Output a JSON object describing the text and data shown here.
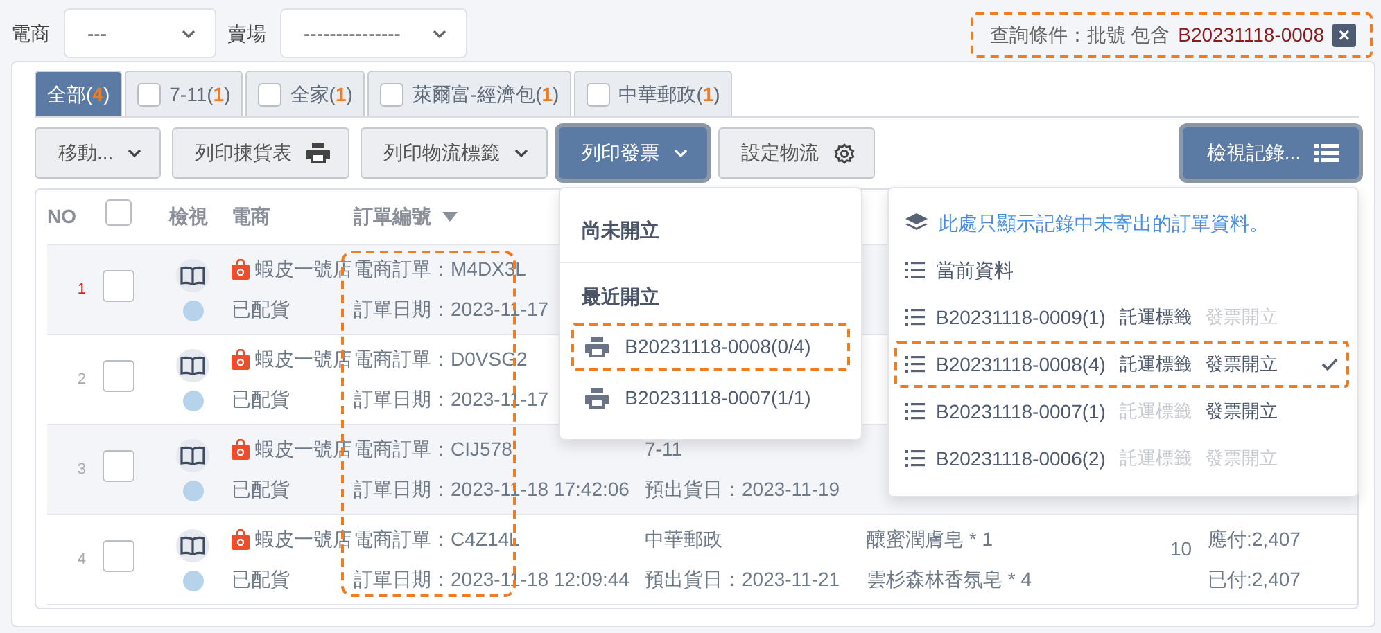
{
  "filters": [
    {
      "label": "電商",
      "value": "---"
    },
    {
      "label": "賣場",
      "value": "---------------"
    }
  ],
  "query": {
    "label": "查詢條件：批號 包含",
    "value": "B20231118-0008",
    "close": "×",
    "highlighted": true
  },
  "tabs": [
    {
      "label": "全部(",
      "count": "4",
      "label_end": ")",
      "selected": true
    },
    {
      "label": "7-11(",
      "count": "1",
      "label_end": ")",
      "selected": false,
      "checked": false
    },
    {
      "label": "全家(",
      "count": "1",
      "label_end": ")",
      "selected": false,
      "checked": false
    },
    {
      "label": "萊爾富-經濟包(",
      "count": "1",
      "label_end": ")",
      "selected": false,
      "checked": false
    },
    {
      "label": "中華郵政(",
      "count": "1",
      "label_end": ")",
      "selected": false,
      "checked": false
    }
  ],
  "toolbar": [
    {
      "label": "移動...",
      "open": false
    },
    {
      "label": "列印揀貨表",
      "open": false
    },
    {
      "label": "列印物流標籤",
      "open": false
    },
    {
      "label": "列印發票",
      "open": true,
      "menu": {
        "kind": "sections",
        "sections": [
          {
            "title": "尚未開立"
          },
          {
            "title": "最近開立",
            "items": [
              {
                "label": "B20231118-0008(0/4)",
                "highlighted": true
              },
              {
                "label": "B20231118-0007(1/1)",
                "highlighted": false
              }
            ]
          }
        ]
      }
    },
    {
      "label": "設定物流",
      "open": false
    },
    {
      "label": "檢視記錄...",
      "open": true,
      "menu": {
        "kind": "records",
        "items": [
          {
            "kind": "note",
            "label": "此處只顯示記錄中未寄出的訂單資料。"
          },
          {
            "kind": "record",
            "label": "當前資料",
            "selected": false,
            "highlighted": false
          },
          {
            "kind": "record",
            "label": "B20231118-0009(1)",
            "tags": [
              {
                "label": "託運標籤",
                "active": true
              },
              {
                "label": "發票開立",
                "active": false
              }
            ],
            "selected": false,
            "highlighted": false
          },
          {
            "kind": "record",
            "label": "B20231118-0008(4)",
            "tags": [
              {
                "label": "託運標籤",
                "active": true
              },
              {
                "label": "發票開立",
                "active": true
              }
            ],
            "selected": true,
            "highlighted": true
          },
          {
            "kind": "record",
            "label": "B20231118-0007(1)",
            "tags": [
              {
                "label": "託運標籤",
                "active": false
              },
              {
                "label": "發票開立",
                "active": true
              }
            ],
            "selected": false,
            "highlighted": false
          },
          {
            "kind": "record",
            "label": "B20231118-0006(2)",
            "tags": [
              {
                "label": "託運標籤",
                "active": false
              },
              {
                "label": "發票開立",
                "active": false
              }
            ],
            "selected": false,
            "highlighted": false
          }
        ]
      }
    }
  ],
  "table": {
    "columns": [
      {
        "kind": "text",
        "label": "NO"
      },
      {
        "kind": "checkbox",
        "checked": false
      },
      {
        "kind": "text",
        "label": "檢視"
      },
      {
        "kind": "text",
        "label": "電商"
      },
      {
        "kind": "text",
        "label": "訂單編號",
        "sorted": true
      }
    ],
    "order_column_highlighted": true,
    "rows": [
      {
        "no": "1",
        "current": true,
        "checked": false,
        "store": "蝦皮一號店",
        "status": "已配貨",
        "order": "電商訂單：M4DX3L",
        "date": "訂單日期：2023-11-17"
      },
      {
        "no": "2",
        "current": false,
        "checked": false,
        "store": "蝦皮一號店",
        "status": "已配貨",
        "order": "電商訂單：D0VSG2",
        "date": "訂單日期：2023-11-17"
      },
      {
        "no": "3",
        "current": false,
        "checked": false,
        "store": "蝦皮一號店",
        "status": "已配貨",
        "order": "電商訂單：CIJ578",
        "date": "訂單日期：2023-11-18 17:42:06",
        "carrier": "7-11",
        "ship_date": "預出貨日：2023-11-19"
      },
      {
        "no": "4",
        "current": false,
        "checked": false,
        "store": "蝦皮一號店",
        "status": "已配貨",
        "order": "電商訂單：C4Z14L",
        "date": "訂單日期：2023-11-18 12:09:44",
        "carrier": "中華郵政",
        "ship_date": "預出貨日：2023-11-21",
        "items": [
          "釀蜜潤膚皂 * 1",
          "雲杉森林香氛皂 * 4"
        ],
        "quantity": "10",
        "payable": "應付:2,407",
        "paid": "已付:2,407"
      }
    ]
  }
}
